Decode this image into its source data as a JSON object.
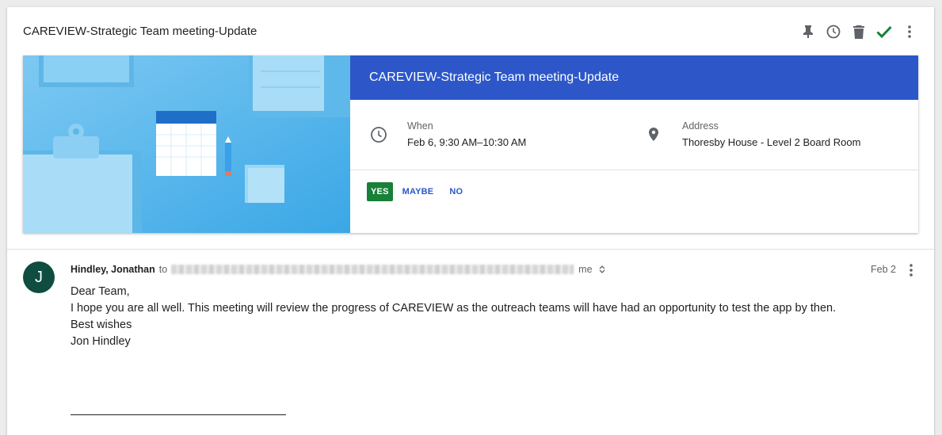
{
  "header": {
    "subject": "CAREVIEW-Strategic Team meeting-Update",
    "icons": [
      "pin-icon",
      "snooze-icon",
      "delete-icon",
      "check-icon",
      "more-icon"
    ],
    "check_color": "#188038"
  },
  "event": {
    "title": "CAREVIEW-Strategic Team meeting-Update",
    "titlebar_color": "#2d57c9",
    "when_label": "When",
    "when_value": "Feb 6, 9:30 AM–10:30 AM",
    "address_label": "Address",
    "address_value": "Thoresby House - Level 2 Board Room",
    "rsvp": {
      "yes": "YES",
      "maybe": "MAYBE",
      "no": "NO",
      "selected": "YES"
    },
    "selected_color": "#188038"
  },
  "message": {
    "avatar_initial": "J",
    "avatar_color": "#0e4d3f",
    "sender": "Hindley, Jonathan",
    "to_label": "to",
    "me_label": "me",
    "date": "Feb 2",
    "body": {
      "line1": "Dear Team,",
      "line2": "I hope you are all well. This meeting will review the progress of CAREVIEW as the outreach teams will have had an opportunity to test the app by then.",
      "line3": "Best wishes",
      "line4": "Jon Hindley"
    }
  }
}
